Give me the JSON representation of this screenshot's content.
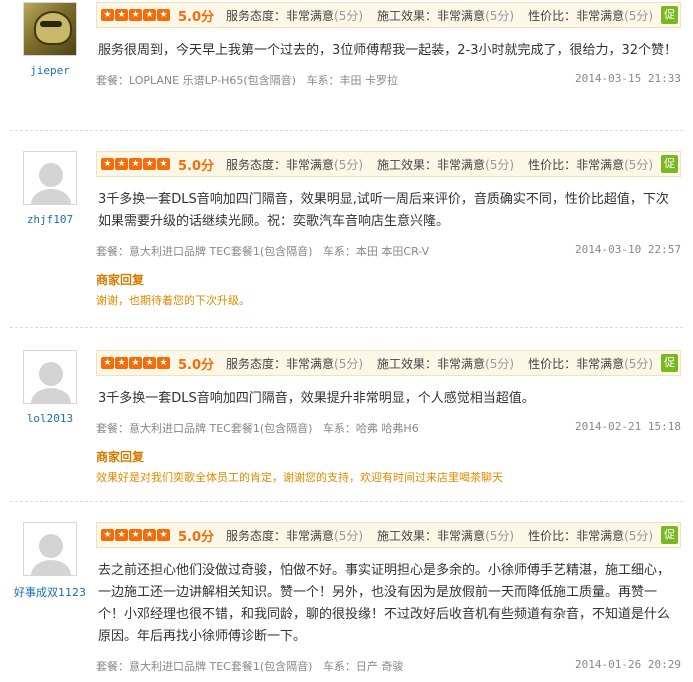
{
  "reviews": [
    {
      "username": "jieper",
      "avatar": "photo",
      "score": "5.0分",
      "metrics": [
        {
          "label": "服务态度：非常满意",
          "sub": "(5分)"
        },
        {
          "label": "施工效果：非常满意",
          "sub": "(5分)"
        },
        {
          "label": "性价比：非常满意",
          "sub": "(5分)"
        }
      ],
      "badge": "促",
      "text": "服务很周到，今天早上我第一个过去的，3位师傅帮我一起装，2-3小时就完成了，很给力，32个赞！",
      "package": "套餐：LOPLANE 乐谱LP-H65(包含隔音)",
      "car": "车系：丰田 卡罗拉",
      "date": "2014-03-15 21:33"
    },
    {
      "username": "zhjf107",
      "avatar": "default",
      "score": "5.0分",
      "metrics": [
        {
          "label": "服务态度：非常满意",
          "sub": "(5分)"
        },
        {
          "label": "施工效果：非常满意",
          "sub": "(5分)"
        },
        {
          "label": "性价比：非常满意",
          "sub": "(5分)"
        }
      ],
      "badge": "促",
      "text": "3千多换一套DLS音响加四门隔音，效果明显,试听一周后来评价，音质确实不同，性价比超值，下次如果需要升级的话继续光顾。祝：奕歌汽车音响店生意兴隆。",
      "package": "套餐：意大利进口品牌 TEC套餐1(包含隔音)",
      "car": "车系：本田 本田CR-V",
      "date": "2014-03-10 22:57",
      "reply_title": "商家回复",
      "reply_text": "谢谢，也期待着您的下次升级。"
    },
    {
      "username": "lol2013",
      "avatar": "default",
      "score": "5.0分",
      "metrics": [
        {
          "label": "服务态度：非常满意",
          "sub": "(5分)"
        },
        {
          "label": "施工效果：非常满意",
          "sub": "(5分)"
        },
        {
          "label": "性价比：非常满意",
          "sub": "(5分)"
        }
      ],
      "badge": "促",
      "text": "3千多换一套DLS音响加四门隔音，效果提升非常明显，个人感觉相当超值。",
      "package": "套餐：意大利进口品牌 TEC套餐1(包含隔音)",
      "car": "车系：哈弗 哈弗H6",
      "date": "2014-02-21 15:18",
      "reply_title": "商家回复",
      "reply_text": "效果好是对我们奕歌全体员工的肯定，谢谢您的支持，欢迎有时间过来店里喝茶聊天"
    },
    {
      "username": "好事成双1123",
      "avatar": "default",
      "score": "5.0分",
      "metrics": [
        {
          "label": "服务态度：非常满意",
          "sub": "(5分)"
        },
        {
          "label": "施工效果：非常满意",
          "sub": "(5分)"
        },
        {
          "label": "性价比：非常满意",
          "sub": "(5分)"
        }
      ],
      "badge": "促",
      "text": "去之前还担心他们没做过奇骏，怕做不好。事实证明担心是多余的。小徐师傅手艺精湛，施工细心，一边施工还一边讲解相关知识。赞一个！另外，也没有因为是放假前一天而降低施工质量。再赞一个！小邓经理也很不错，和我同龄，聊的很投缘！不过改好后收音机有些频道有杂音，不知道是什么原因。年后再找小徐师傅诊断一下。",
      "package": "套餐：意大利进口品牌 TEC套餐1(包含隔音)",
      "car": "车系：日产 奇骏",
      "date": "2014-01-26 20:29"
    }
  ],
  "colors": {
    "accent": "#f36d0a",
    "reply": "#d47a00",
    "link": "#1a6fb5",
    "badge": "#7ab821"
  }
}
